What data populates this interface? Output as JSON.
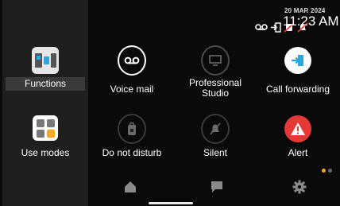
{
  "status": {
    "date": "20 MAR 2024",
    "time": "11:23 AM",
    "icons": [
      "voicemail-icon",
      "call-forward-icon",
      "do-not-disturb-icon",
      "silent-icon"
    ]
  },
  "tiles": [
    {
      "id": "functions",
      "label": "Functions",
      "icon": "phone-functions-icon",
      "selected": true
    },
    {
      "id": "voice-mail",
      "label": "Voice mail",
      "icon": "voicemail-icon"
    },
    {
      "id": "professional-studio",
      "label": "Professional Studio",
      "icon": "monitor-icon"
    },
    {
      "id": "call-forwarding",
      "label": "Call forwarding",
      "icon": "call-forward-icon"
    },
    {
      "id": "use-modes",
      "label": "Use modes",
      "icon": "use-modes-grid-icon"
    },
    {
      "id": "do-not-disturb",
      "label": "Do not disturb",
      "icon": "door-hanger-icon"
    },
    {
      "id": "silent",
      "label": "Silent",
      "icon": "bell-muted-icon"
    },
    {
      "id": "alert",
      "label": "Alert",
      "icon": "alert-triangle-icon"
    }
  ],
  "pager": {
    "pages": 2,
    "current": 1
  },
  "nav": [
    "home-icon",
    "chat-icon",
    "settings-gear-icon"
  ],
  "colors": {
    "accent": "#f5a623",
    "alert": "#e53935",
    "icon_grey": "#8a8a8a",
    "icon_dark_grey": "#555555"
  }
}
